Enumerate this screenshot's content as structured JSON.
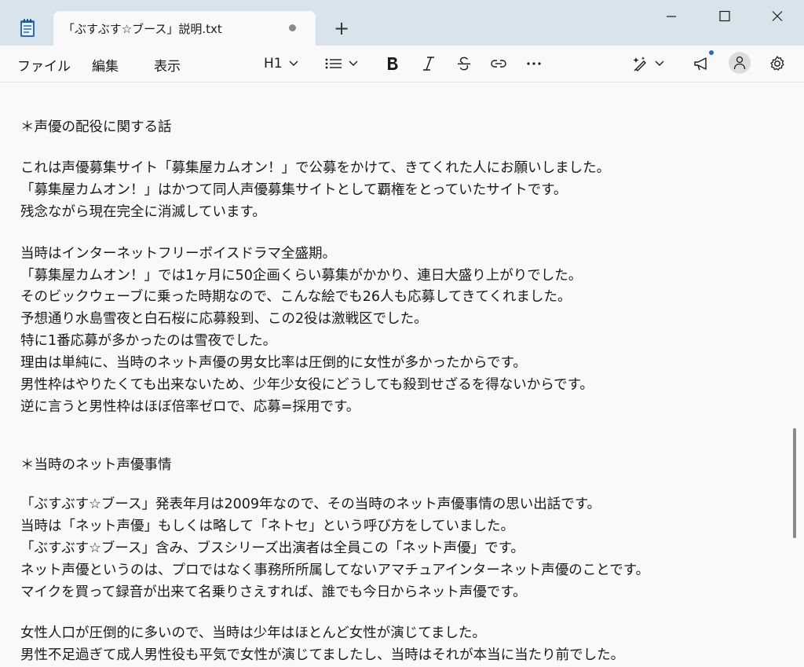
{
  "tab": {
    "title": "「ぶすぶす☆ブース」説明.txt",
    "new_tab_label": "+"
  },
  "menu": {
    "file": "ファイル",
    "edit": "編集",
    "view": "表示"
  },
  "format_toolbar": {
    "heading_label": "H1"
  },
  "document": {
    "lines": [
      "＊声優の配役に関する話",
      "これは声優募集サイト「募集屋カムオン！」で公募をかけて、きてくれた人にお願いしました。",
      "「募集屋カムオン！」はかつて同人声優募集サイトとして覇権をとっていたサイトです。",
      "残念ながら現在完全に消滅しています。",
      "当時はインターネットフリーボイスドラマ全盛期。",
      "「募集屋カムオン！」では1ヶ月に50企画くらい募集がかかり、連日大盛り上がりでした。",
      "そのビックウェーブに乗った時期なので、こんな絵でも26人も応募してきてくれました。",
      "予想通り水島雪夜と白石桜に応募殺到、この2役は激戦区でした。",
      "特に1番応募が多かったのは雪夜でした。",
      "理由は単純に、当時のネット声優の男女比率は圧倒的に女性が多かったからです。",
      "男性枠はやりたくても出来ないため、少年少女役にどうしても殺到せざるを得ないからです。",
      "逆に言うと男性枠はほぼ倍率ゼロで、応募=採用です。",
      "＊当時のネット声優事情",
      "「ぶすぶす☆ブース」発表年月は2009年なので、その当時のネット声優事情の思い出話です。",
      "当時は「ネット声優」もしくは略して「ネトセ」という呼び方をしていました。",
      "「ぶすぶす☆ブース」含み、ブスシリーズ出演者は全員この「ネット声優」です。",
      "ネット声優というのは、プロではなく事務所所属してないアマチュアインターネット声優のことです。",
      "マイクを買って録音が出来て名乗りさえすれば、誰でも今日からネット声優です。",
      "女性人口が圧倒的に多いので、当時は少年はほとんど女性が演じてました。",
      "男性不足過ぎて成人男性役も平気で女性が演じてましたし、当時はそれが本当に当たり前でした。"
    ]
  }
}
